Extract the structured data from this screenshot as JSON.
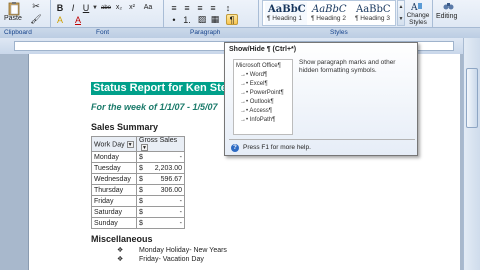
{
  "ribbon": {
    "paste_label": "Paste",
    "groups": {
      "clipboard": "Clipboard",
      "font": "Font",
      "paragraph": "Paragraph",
      "styles": "Styles"
    },
    "font_buttons": [
      "B",
      "I",
      "U",
      "abe",
      "x₂",
      "x²",
      "Aa",
      "A",
      "A"
    ],
    "styles": [
      {
        "sample": "AaBbC",
        "name": "¶ Heading 1"
      },
      {
        "sample": "AaBbC",
        "name": "¶ Heading 2"
      },
      {
        "sample": "AaBbC",
        "name": "¶ Heading 3"
      }
    ],
    "change_styles_label": "Change Styles",
    "editing_label": "Editing"
  },
  "tooltip": {
    "title": "Show/Hide ¶ (Ctrl+*)",
    "description": "Show paragraph marks and other hidden formatting symbols.",
    "help_text": "Press F1 for more help.",
    "preview_items": [
      "Microsoft Office¶",
      "→• Word¶",
      "→• Excel¶",
      "→• PowerPoint¶",
      "→• Outlook¶",
      "→• Access¶",
      "→• InfoPath¶"
    ]
  },
  "document": {
    "title": "Status Report for Ken Ste",
    "subtitle": "For the week of 1/1/07  -  1/5/07",
    "sales_heading": "Sales Summary",
    "table": {
      "headers": [
        "Work Day",
        "Gross Sales"
      ],
      "rows": [
        {
          "day": "Monday",
          "cur": "$",
          "amt": "-"
        },
        {
          "day": "Tuesday",
          "cur": "$",
          "amt": "2,203.00"
        },
        {
          "day": "Wednesday",
          "cur": "$",
          "amt": "596.67"
        },
        {
          "day": "Thursday",
          "cur": "$",
          "amt": "306.00"
        },
        {
          "day": "Friday",
          "cur": "$",
          "amt": "-"
        },
        {
          "day": "Saturday",
          "cur": "$",
          "amt": "-"
        },
        {
          "day": "Sunday",
          "cur": "$",
          "amt": "-"
        }
      ]
    },
    "misc_heading": "Miscellaneous",
    "misc_items": [
      "Monday Holiday- New Years",
      "Friday- Vacation Day"
    ],
    "bullet_glyph": "❖"
  },
  "colors": {
    "title_bg": "#00a08a",
    "subtitle": "#1a7a6a",
    "ribbon_highlight": "#f9c54f"
  }
}
